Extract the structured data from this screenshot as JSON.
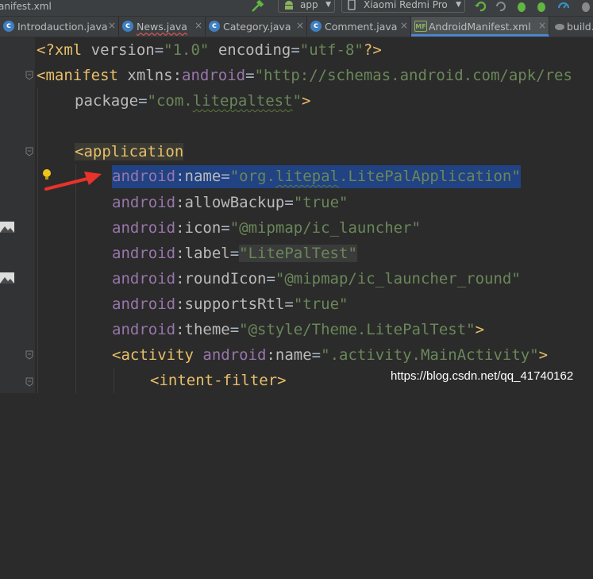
{
  "window": {
    "file_title": "anifest.xml"
  },
  "toolbar": {
    "module_label": "app",
    "device_label": "Xiaomi Redmi Pro"
  },
  "tabs": [
    {
      "label": "Introdauction.java",
      "icon": "java-class-icon",
      "has_error": false
    },
    {
      "label": "News.java",
      "icon": "java-class-icon",
      "has_error": true
    },
    {
      "label": "Category.java",
      "icon": "java-class-icon",
      "has_error": false
    },
    {
      "label": "Comment.java",
      "icon": "java-class-icon",
      "has_error": false
    },
    {
      "label": "AndroidManifest.xml",
      "icon": "manifest-file-icon",
      "has_error": false,
      "active": true
    },
    {
      "label": "build.",
      "icon": "gradle-icon",
      "has_error": false
    }
  ],
  "code": {
    "line1": {
      "pi_open": "<?xml ",
      "a1": "version",
      "eq1": "=",
      "v1": "\"1.0\"",
      "sp": " ",
      "a2": "encoding",
      "eq2": "=",
      "v2": "\"utf-8\"",
      "pi_close": "?>"
    },
    "line2": {
      "tag": "<manifest ",
      "a1": "xmlns:",
      "ns": "android",
      "eq": "=",
      "v": "\"http://schemas.android.com/apk/res"
    },
    "line3": {
      "a": "package",
      "eq": "=",
      "v_pre": "\"com.",
      "v_word": "litepaltest",
      "v_post": "\"",
      "close": ">"
    },
    "line5": {
      "tag": "<application"
    },
    "line6": {
      "ns": "android",
      "a": ":name",
      "eq": "=",
      "v_pre": "\"org.",
      "v_word": "litepal",
      "v_post": ".LitePalApplication\""
    },
    "line7": {
      "ns": "android",
      "a": ":allowBackup",
      "eq": "=",
      "v": "\"true\""
    },
    "line8": {
      "ns": "android",
      "a": ":icon",
      "eq": "=",
      "v": "\"@mipmap/ic_launcher\""
    },
    "line9": {
      "ns": "android",
      "a": ":label",
      "eq": "=",
      "v": "\"LitePalTest\""
    },
    "line10": {
      "ns": "android",
      "a": ":roundIcon",
      "eq": "=",
      "v": "\"@mipmap/ic_launcher_round\""
    },
    "line11": {
      "ns": "android",
      "a": ":supportsRtl",
      "eq": "=",
      "v": "\"true\""
    },
    "line12": {
      "ns": "android",
      "a": ":theme",
      "eq": "=",
      "v": "\"@style/Theme.LitePalTest\"",
      "close": ">"
    },
    "line13": {
      "tag": "<activity ",
      "ns": "android",
      "a": ":name",
      "eq": "=",
      "v": "\".activity.MainActivity\"",
      "close": ">"
    },
    "line14": {
      "tag": "<intent-filter",
      "close": ">"
    }
  },
  "watermark": "https://blog.csdn.net/qq_41740162",
  "colors": {
    "editor_bg": "#2b2b2b",
    "tag": "#e8bf6a",
    "namespace": "#9876aa",
    "string": "#6a8759",
    "selection": "#214283",
    "arrow": "#e8332a"
  }
}
